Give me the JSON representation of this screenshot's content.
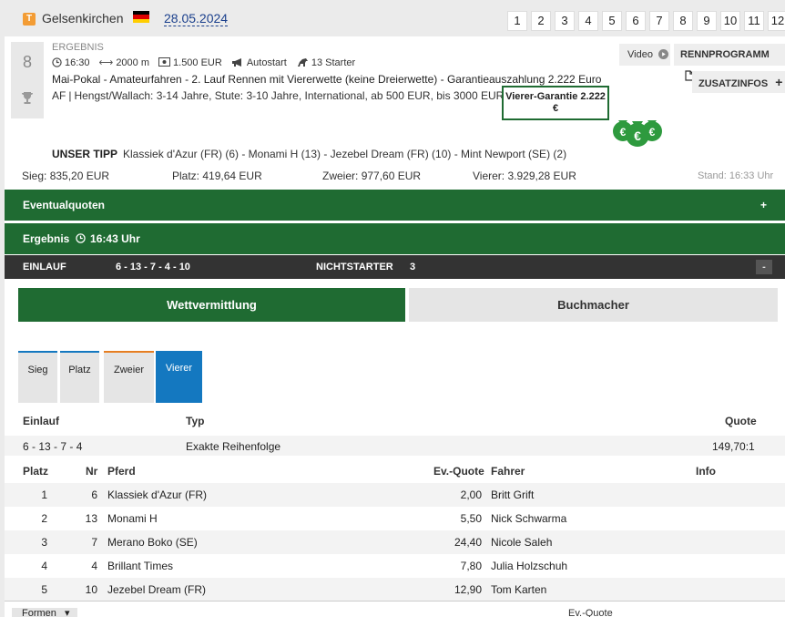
{
  "header": {
    "track_logo": "T",
    "track": "Gelsenkirchen",
    "flag_colors": [
      "#000000",
      "#dd0000",
      "#ffce00"
    ],
    "date": "28.05.2024",
    "race_numbers": [
      "1",
      "2",
      "3",
      "4",
      "5",
      "6",
      "7",
      "8",
      "9",
      "10",
      "11",
      "12"
    ]
  },
  "race": {
    "number": "8",
    "status_label": "ERGEBNIS",
    "time": "16:30",
    "distance": "2000 m",
    "prize": "1.500 EUR",
    "start_type": "Autostart",
    "starters": "13 Starter",
    "title": "Mai-Pokal - Amateurfahren - 2. Lauf Rennen mit Viererwette (keine Dreierwette) - Garantieauszahlung 2.222 Euro",
    "conditions_prefix": "AF",
    "conditions": "Hengst/Wallach: 3-14 Jahre, Stute: 3-10 Jahre, International, ab 500 EUR, bis 3000 EUR",
    "guarantee": "Vierer-Garantie 2.222 €",
    "icons": [
      "clock-icon",
      "distance-icon",
      "money-icon",
      "megaphone-icon",
      "horse-icon",
      "trophy-icon",
      "money-bags-icon"
    ]
  },
  "buttons": {
    "video": "Video",
    "rennprogramm": "RENNPROGRAMM",
    "zusatzinfos": "ZUSATZINFOS"
  },
  "tipp": {
    "label": "UNSER TIPP",
    "text": "Klassiek d'Azur (FR) (6) - Monami H (13) - Jezebel Dream (FR) (10) - Mint Newport (SE) (2)"
  },
  "totals": {
    "sieg_label": "Sieg:",
    "sieg": "835,20 EUR",
    "platz_label": "Platz:",
    "platz": "419,64 EUR",
    "zweier_label": "Zweier:",
    "zweier": "977,60 EUR",
    "vierer_label": "Vierer:",
    "vierer": "3.929,28 EUR",
    "stand": "Stand: 16:33 Uhr"
  },
  "eventual": {
    "label": "Eventualquoten",
    "toggle": "+"
  },
  "ergebnis_bar": {
    "label": "Ergebnis",
    "time": "16:43 Uhr"
  },
  "einlauf_bar": {
    "einlauf_label": "EINLAUF",
    "einlauf": "6 - 13 - 7 - 4 - 10",
    "nichtstarter_label": "NICHTSTARTER",
    "nichtstarter": "3",
    "toggle": "-"
  },
  "main_tabs": [
    "Wettvermittlung",
    "Buchmacher"
  ],
  "bet_tabs": [
    "Sieg",
    "Platz",
    "Zweier",
    "Vierer"
  ],
  "bet_tab_colors": [
    "#1478c0",
    "#1478c0",
    "#e67e22",
    "#1478c0"
  ],
  "result_table": {
    "headers": [
      "Einlauf",
      "Typ",
      "Quote"
    ],
    "row": [
      "6 - 13 - 7 - 4",
      "Exakte Reihenfolge",
      "149,70:1"
    ]
  },
  "horse_table": {
    "headers": [
      "Platz",
      "Nr",
      "Pferd",
      "Ev.-Quote",
      "Fahrer",
      "Info"
    ],
    "rows": [
      [
        "1",
        "6",
        "Klassiek d'Azur (FR)",
        "2,00",
        "Britt Grift"
      ],
      [
        "2",
        "13",
        "Monami H",
        "5,50",
        "Nick Schwarma"
      ],
      [
        "3",
        "7",
        "Merano Boko (SE)",
        "24,40",
        "Nicole Saleh"
      ],
      [
        "4",
        "4",
        "Brillant Times",
        "7,80",
        "Julia Holzschuh"
      ],
      [
        "5",
        "10",
        "Jezebel Dream (FR)",
        "12,90",
        "Tom Karten"
      ]
    ]
  },
  "footer": {
    "formen": "Formen",
    "evquote": "Ev.-Quote"
  }
}
